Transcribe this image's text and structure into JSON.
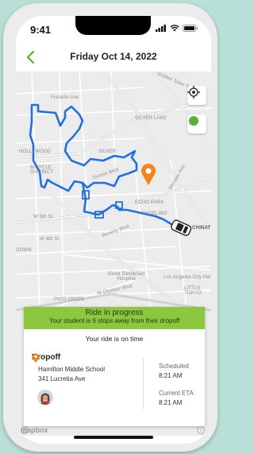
{
  "status_bar": {
    "time": "9:41"
  },
  "header": {
    "title": "Friday Oct 14, 2022"
  },
  "map": {
    "labels": {
      "franklin_ave": "Franklin Ave",
      "hollywood": "HOLLYWOOD",
      "bicycle_district": "BICYCLE\nDISTRICT",
      "silver_lake_top": "SILVER LAKE",
      "silver_lake_mid": "SILVER",
      "sunset_blvd": "Sunset Blvd",
      "melrose": "Melrose Ave",
      "echo_park": "ECHO PARK",
      "angelino_heights": "ANGELINO",
      "beverly": "Beverly Blvd",
      "w5th": "W 5th St",
      "w6th": "W 6th St",
      "chinatown": "CHINAT",
      "good_sam": "Good Samaritan\nHospital",
      "la_city_hall": "Los Angeles City Hal",
      "little_tokyo": "LITTLE\nTOKYO",
      "w_olympic": "W Olympic Blvd",
      "pico_union": "PICO-UNION",
      "golden_state": "Golden State Fwy",
      "down": "DOWN"
    },
    "attribution": "mapbox"
  },
  "ride_card": {
    "banner_title": "Ride in progress",
    "banner_subtitle": "Your student is 6 stops away from their dropoff",
    "status_line": "Your ride is on time",
    "dropoff_label": "Dropoff",
    "school_name": "Hamilton Middle School",
    "address": "341 Lucretia Ave",
    "scheduled_label": "Scheduled",
    "scheduled_time": "8:21 AM",
    "eta_label": "Current ETA",
    "eta_time": "8:21 AM"
  },
  "colors": {
    "route": "#1f6fe5",
    "banner": "#8dc63f",
    "pin": "#f5821f",
    "accent_green": "#5ab12f"
  },
  "icons": {
    "back": "chevron-left-icon",
    "locate": "crosshair-icon",
    "toggle": "green-dot-icon",
    "pin": "map-pin-icon",
    "vehicle": "car-icon",
    "dropoff": "location-pin-icon"
  }
}
